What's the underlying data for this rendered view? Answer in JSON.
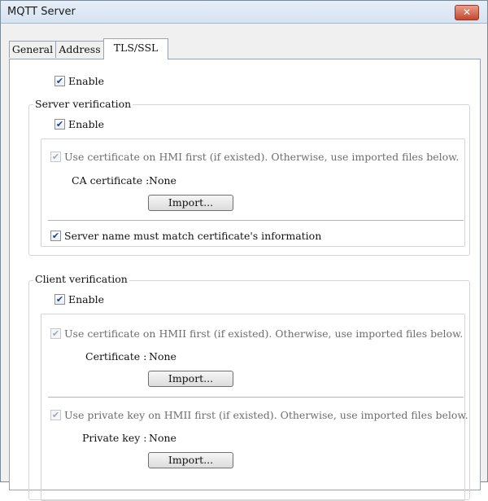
{
  "window": {
    "title": "MQTT Server",
    "close_glyph": "✕"
  },
  "tabs": [
    {
      "label": "General"
    },
    {
      "label": "Address"
    },
    {
      "label": "TLS/SSL",
      "active": true
    }
  ],
  "tls": {
    "enable_label": "Enable",
    "enable_checked": true
  },
  "server_verification": {
    "legend": "Server verification",
    "enable_label": "Enable",
    "enable_checked": true,
    "use_cert_label": "Use certificate on HMI first (if existed). Otherwise, use imported files below.",
    "ca_certificate_label": "CA certificate :",
    "ca_certificate_value": "None",
    "import_label": "Import...",
    "name_match_label": "Server name must match certificate's information",
    "name_match_checked": true
  },
  "client_verification": {
    "legend": "Client verification",
    "enable_label": "Enable",
    "enable_checked": true,
    "use_cert_label": "Use certificate on HMII first (if existed). Otherwise, use imported files below.",
    "certificate_label": "Certificate :",
    "certificate_value": "None",
    "import_cert_label": "Import...",
    "use_key_label": "Use private key on HMII first (if existed). Otherwise, use imported files below.",
    "private_key_label": "Private key :",
    "private_key_value": "None",
    "import_key_label": "Import..."
  },
  "check_glyph": "✔",
  "colors": {
    "titlebar": "#dbe6f3",
    "close_button": "#c6452d",
    "check": "#1c3f94"
  }
}
